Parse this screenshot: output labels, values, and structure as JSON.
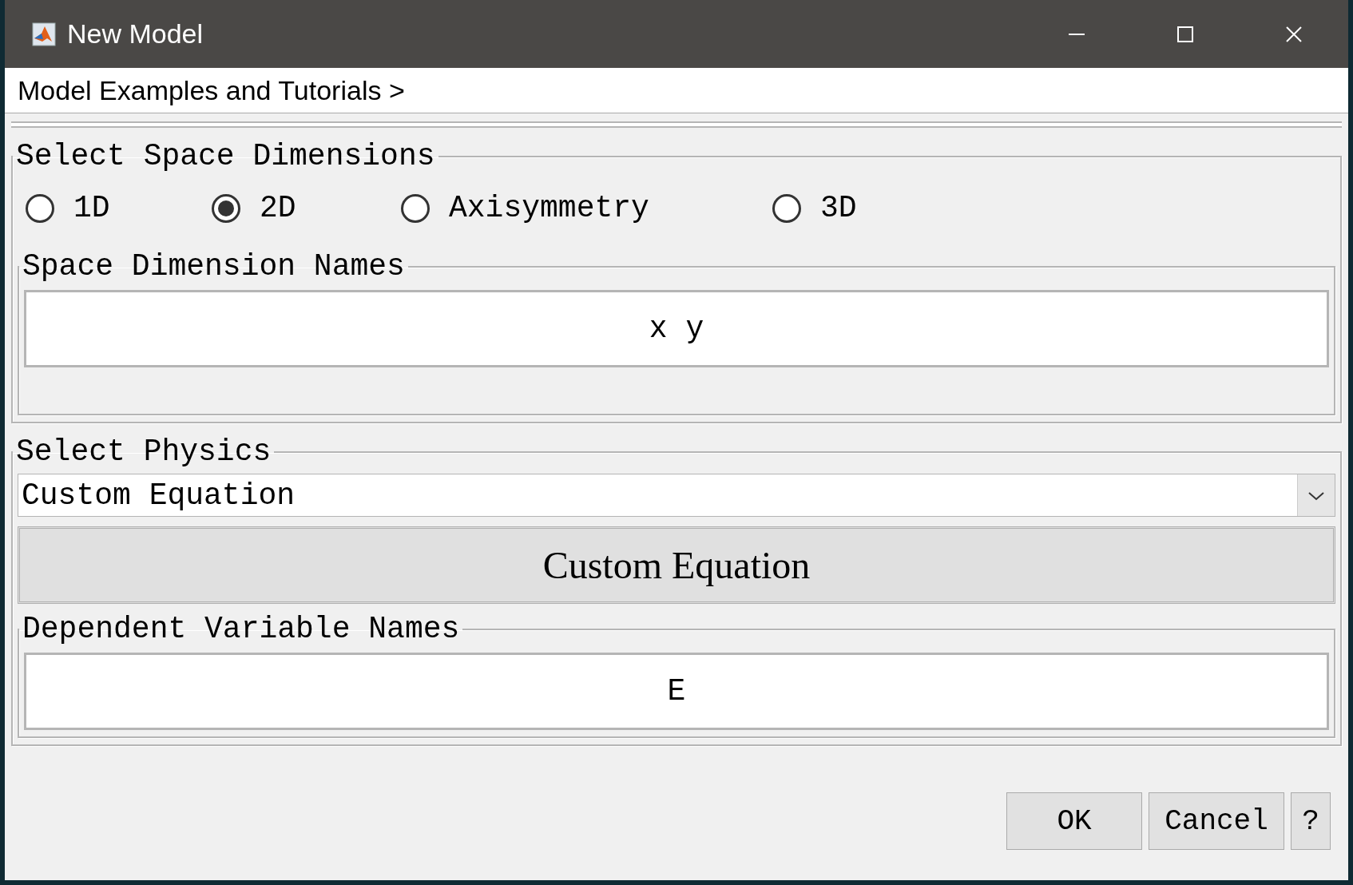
{
  "window": {
    "title": "New Model"
  },
  "breadcrumb": "Model Examples and Tutorials >",
  "space_dimensions": {
    "legend": "Select Space Dimensions",
    "options": [
      {
        "label": "1D",
        "selected": false
      },
      {
        "label": "2D",
        "selected": true
      },
      {
        "label": "Axisymmetry",
        "selected": false
      },
      {
        "label": "3D",
        "selected": false
      }
    ]
  },
  "space_dimension_names": {
    "legend": "Space Dimension Names",
    "value": "x y"
  },
  "physics": {
    "legend": "Select Physics",
    "dropdown_value": "Custom Equation",
    "heading_button": "Custom Equation",
    "dependent_variable_names": {
      "legend": "Dependent Variable Names",
      "value": "E"
    }
  },
  "buttons": [
    "OK",
    "Cancel",
    "?"
  ]
}
